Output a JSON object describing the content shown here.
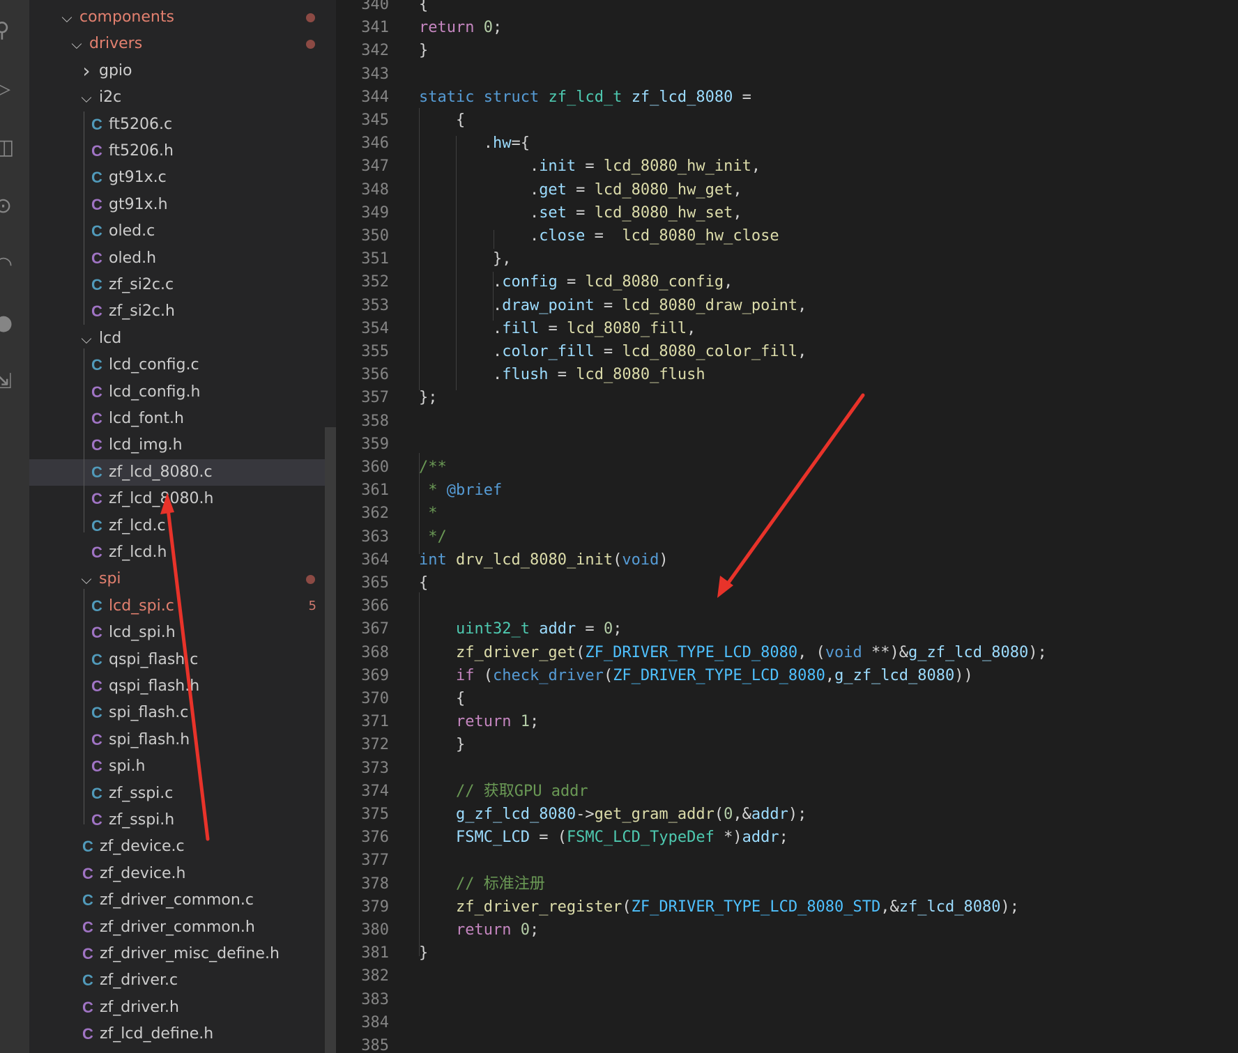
{
  "activity_bar": {
    "icons": [
      "source-control-icon",
      "run-debug-icon",
      "extensions-icon",
      "remote-explorer-icon",
      "wifi-icon",
      "github-icon",
      "live-share-icon"
    ]
  },
  "explorer": {
    "rows": [
      {
        "kind": "folder",
        "label": "components",
        "open": true,
        "modified": true,
        "depth": 0
      },
      {
        "kind": "folder",
        "label": "drivers",
        "open": true,
        "modified": true,
        "depth": 1
      },
      {
        "kind": "folder",
        "label": "gpio",
        "open": false,
        "depth": 2
      },
      {
        "kind": "folder",
        "label": "i2c",
        "open": true,
        "depth": 2
      },
      {
        "kind": "file",
        "label": "ft5206.c",
        "ext": "c",
        "depth": 3
      },
      {
        "kind": "file",
        "label": "ft5206.h",
        "ext": "h",
        "depth": 3
      },
      {
        "kind": "file",
        "label": "gt91x.c",
        "ext": "c",
        "depth": 3
      },
      {
        "kind": "file",
        "label": "gt91x.h",
        "ext": "h",
        "depth": 3
      },
      {
        "kind": "file",
        "label": "oled.c",
        "ext": "c",
        "depth": 3
      },
      {
        "kind": "file",
        "label": "oled.h",
        "ext": "h",
        "depth": 3
      },
      {
        "kind": "file",
        "label": "zf_si2c.c",
        "ext": "c",
        "depth": 3
      },
      {
        "kind": "file",
        "label": "zf_si2c.h",
        "ext": "h",
        "depth": 3
      },
      {
        "kind": "folder",
        "label": "lcd",
        "open": true,
        "depth": 2
      },
      {
        "kind": "file",
        "label": "lcd_config.c",
        "ext": "c",
        "depth": 3
      },
      {
        "kind": "file",
        "label": "lcd_config.h",
        "ext": "h",
        "depth": 3
      },
      {
        "kind": "file",
        "label": "lcd_font.h",
        "ext": "h",
        "depth": 3
      },
      {
        "kind": "file",
        "label": "lcd_img.h",
        "ext": "h",
        "depth": 3
      },
      {
        "kind": "file",
        "label": "zf_lcd_8080.c",
        "ext": "c",
        "depth": 3,
        "selected": true
      },
      {
        "kind": "file",
        "label": "zf_lcd_8080.h",
        "ext": "h",
        "depth": 3
      },
      {
        "kind": "file",
        "label": "zf_lcd.c",
        "ext": "c",
        "depth": 3
      },
      {
        "kind": "file",
        "label": "zf_lcd.h",
        "ext": "h",
        "depth": 3
      },
      {
        "kind": "folder",
        "label": "spi",
        "open": true,
        "modified": true,
        "depth": 2
      },
      {
        "kind": "file",
        "label": "lcd_spi.c",
        "ext": "c",
        "depth": 3,
        "modified": true,
        "count": "5"
      },
      {
        "kind": "file",
        "label": "lcd_spi.h",
        "ext": "h",
        "depth": 3
      },
      {
        "kind": "file",
        "label": "qspi_flash.c",
        "ext": "c",
        "depth": 3
      },
      {
        "kind": "file",
        "label": "qspi_flash.h",
        "ext": "h",
        "depth": 3
      },
      {
        "kind": "file",
        "label": "spi_flash.c",
        "ext": "c",
        "depth": 3
      },
      {
        "kind": "file",
        "label": "spi_flash.h",
        "ext": "h",
        "depth": 3
      },
      {
        "kind": "file",
        "label": "spi.h",
        "ext": "h",
        "depth": 3
      },
      {
        "kind": "file",
        "label": "zf_sspi.c",
        "ext": "c",
        "depth": 3
      },
      {
        "kind": "file",
        "label": "zf_sspi.h",
        "ext": "h",
        "depth": 3
      },
      {
        "kind": "file",
        "label": "zf_device.c",
        "ext": "c",
        "depth": 2
      },
      {
        "kind": "file",
        "label": "zf_device.h",
        "ext": "h",
        "depth": 2
      },
      {
        "kind": "file",
        "label": "zf_driver_common.c",
        "ext": "c",
        "depth": 2
      },
      {
        "kind": "file",
        "label": "zf_driver_common.h",
        "ext": "h",
        "depth": 2
      },
      {
        "kind": "file",
        "label": "zf_driver_misc_define.h",
        "ext": "h",
        "depth": 2
      },
      {
        "kind": "file",
        "label": "zf_driver.c",
        "ext": "c",
        "depth": 2
      },
      {
        "kind": "file",
        "label": "zf_driver.h",
        "ext": "h",
        "depth": 2
      },
      {
        "kind": "file",
        "label": "zf_lcd_define.h",
        "ext": "h",
        "depth": 2
      }
    ]
  },
  "editor": {
    "lines": [
      {
        "n": "340",
        "t": [
          {
            "s": "{"
          }
        ]
      },
      {
        "n": "341",
        "t": [
          {
            "s": "return",
            "c": "ctl"
          },
          {
            "s": " "
          },
          {
            "s": "0",
            "c": "num"
          },
          {
            "s": ";"
          }
        ]
      },
      {
        "n": "342",
        "t": [
          {
            "s": "}"
          }
        ]
      },
      {
        "n": "343",
        "t": []
      },
      {
        "n": "344",
        "t": [
          {
            "s": "static",
            "c": "kw"
          },
          {
            "s": " "
          },
          {
            "s": "struct",
            "c": "kw"
          },
          {
            "s": " "
          },
          {
            "s": "zf_lcd_t",
            "c": "typ"
          },
          {
            "s": " "
          },
          {
            "s": "zf_lcd_8080",
            "c": "var"
          },
          {
            "s": " ="
          }
        ]
      },
      {
        "n": "345",
        "t": [
          {
            "s": "    {"
          }
        ]
      },
      {
        "n": "346",
        "t": [
          {
            "s": "       ."
          },
          {
            "s": "hw",
            "c": "var"
          },
          {
            "s": "={"
          }
        ]
      },
      {
        "n": "347",
        "t": [
          {
            "s": "            ."
          },
          {
            "s": "init",
            "c": "var"
          },
          {
            "s": " = "
          },
          {
            "s": "lcd_8080_hw_init",
            "c": "fn"
          },
          {
            "s": ","
          }
        ]
      },
      {
        "n": "348",
        "t": [
          {
            "s": "            ."
          },
          {
            "s": "get",
            "c": "var"
          },
          {
            "s": " = "
          },
          {
            "s": "lcd_8080_hw_get",
            "c": "fn"
          },
          {
            "s": ","
          }
        ]
      },
      {
        "n": "349",
        "t": [
          {
            "s": "            ."
          },
          {
            "s": "set",
            "c": "var"
          },
          {
            "s": " = "
          },
          {
            "s": "lcd_8080_hw_set",
            "c": "fn"
          },
          {
            "s": ","
          }
        ]
      },
      {
        "n": "350",
        "t": [
          {
            "s": "            ."
          },
          {
            "s": "close",
            "c": "var"
          },
          {
            "s": " =  "
          },
          {
            "s": "lcd_8080_hw_close",
            "c": "fn"
          }
        ]
      },
      {
        "n": "351",
        "t": [
          {
            "s": "        },"
          }
        ]
      },
      {
        "n": "352",
        "t": [
          {
            "s": "        ."
          },
          {
            "s": "config",
            "c": "var"
          },
          {
            "s": " = "
          },
          {
            "s": "lcd_8080_config",
            "c": "fn"
          },
          {
            "s": ","
          }
        ]
      },
      {
        "n": "353",
        "t": [
          {
            "s": "        ."
          },
          {
            "s": "draw_point",
            "c": "var"
          },
          {
            "s": " = "
          },
          {
            "s": "lcd_8080_draw_point",
            "c": "fn"
          },
          {
            "s": ","
          }
        ]
      },
      {
        "n": "354",
        "t": [
          {
            "s": "        ."
          },
          {
            "s": "fill",
            "c": "var"
          },
          {
            "s": " = "
          },
          {
            "s": "lcd_8080_fill",
            "c": "fn"
          },
          {
            "s": ","
          }
        ]
      },
      {
        "n": "355",
        "t": [
          {
            "s": "        ."
          },
          {
            "s": "color_fill",
            "c": "var"
          },
          {
            "s": " = "
          },
          {
            "s": "lcd_8080_color_fill",
            "c": "fn"
          },
          {
            "s": ","
          }
        ]
      },
      {
        "n": "356",
        "t": [
          {
            "s": "        ."
          },
          {
            "s": "flush",
            "c": "var"
          },
          {
            "s": " = "
          },
          {
            "s": "lcd_8080_flush",
            "c": "fn"
          }
        ]
      },
      {
        "n": "357",
        "t": [
          {
            "s": "};"
          }
        ]
      },
      {
        "n": "358",
        "t": []
      },
      {
        "n": "359",
        "t": []
      },
      {
        "n": "360",
        "t": [
          {
            "s": "/**",
            "c": "cmt"
          }
        ]
      },
      {
        "n": "361",
        "t": [
          {
            "s": " * ",
            "c": "cmt"
          },
          {
            "s": "@brief",
            "c": "kw"
          }
        ]
      },
      {
        "n": "362",
        "t": [
          {
            "s": " *",
            "c": "cmt"
          }
        ]
      },
      {
        "n": "363",
        "t": [
          {
            "s": " */",
            "c": "cmt"
          }
        ]
      },
      {
        "n": "364",
        "t": [
          {
            "s": "int",
            "c": "kw"
          },
          {
            "s": " "
          },
          {
            "s": "drv_lcd_8080_init",
            "c": "fn"
          },
          {
            "s": "("
          },
          {
            "s": "void",
            "c": "kw"
          },
          {
            "s": ")"
          }
        ]
      },
      {
        "n": "365",
        "t": [
          {
            "s": "{"
          }
        ]
      },
      {
        "n": "366",
        "t": []
      },
      {
        "n": "367",
        "t": [
          {
            "s": "    "
          },
          {
            "s": "uint32_t",
            "c": "typ"
          },
          {
            "s": " "
          },
          {
            "s": "addr",
            "c": "var"
          },
          {
            "s": " = "
          },
          {
            "s": "0",
            "c": "num"
          },
          {
            "s": ";"
          }
        ]
      },
      {
        "n": "368",
        "t": [
          {
            "s": "    "
          },
          {
            "s": "zf_driver_get",
            "c": "fn"
          },
          {
            "s": "("
          },
          {
            "s": "ZF_DRIVER_TYPE_LCD_8080",
            "c": "mac"
          },
          {
            "s": ", ("
          },
          {
            "s": "void",
            "c": "kw"
          },
          {
            "s": " **)&"
          },
          {
            "s": "g_zf_lcd_8080",
            "c": "var"
          },
          {
            "s": ");"
          }
        ]
      },
      {
        "n": "369",
        "t": [
          {
            "s": "    "
          },
          {
            "s": "if",
            "c": "ctl"
          },
          {
            "s": " ("
          },
          {
            "s": "check_driver",
            "c": "kw"
          },
          {
            "s": "("
          },
          {
            "s": "ZF_DRIVER_TYPE_LCD_8080",
            "c": "mac"
          },
          {
            "s": ","
          },
          {
            "s": "g_zf_lcd_8080",
            "c": "var"
          },
          {
            "s": "))"
          }
        ]
      },
      {
        "n": "370",
        "t": [
          {
            "s": "    {"
          }
        ]
      },
      {
        "n": "371",
        "t": [
          {
            "s": "    "
          },
          {
            "s": "return",
            "c": "ctl"
          },
          {
            "s": " "
          },
          {
            "s": "1",
            "c": "num"
          },
          {
            "s": ";"
          }
        ]
      },
      {
        "n": "372",
        "t": [
          {
            "s": "    }"
          }
        ]
      },
      {
        "n": "373",
        "t": []
      },
      {
        "n": "374",
        "t": [
          {
            "s": "    // 获取GPU addr",
            "c": "cmt"
          }
        ]
      },
      {
        "n": "375",
        "t": [
          {
            "s": "    "
          },
          {
            "s": "g_zf_lcd_8080",
            "c": "var"
          },
          {
            "s": "->"
          },
          {
            "s": "get_gram_addr",
            "c": "fn"
          },
          {
            "s": "("
          },
          {
            "s": "0",
            "c": "num"
          },
          {
            "s": ",&"
          },
          {
            "s": "addr",
            "c": "var"
          },
          {
            "s": ");"
          }
        ]
      },
      {
        "n": "376",
        "t": [
          {
            "s": "    "
          },
          {
            "s": "FSMC_LCD",
            "c": "var"
          },
          {
            "s": " = ("
          },
          {
            "s": "FSMC_LCD_TypeDef",
            "c": "typ"
          },
          {
            "s": " *)"
          },
          {
            "s": "addr",
            "c": "var"
          },
          {
            "s": ";"
          }
        ]
      },
      {
        "n": "377",
        "t": []
      },
      {
        "n": "378",
        "t": [
          {
            "s": "    // 标准注册",
            "c": "cmt"
          }
        ]
      },
      {
        "n": "379",
        "t": [
          {
            "s": "    "
          },
          {
            "s": "zf_driver_register",
            "c": "fn"
          },
          {
            "s": "("
          },
          {
            "s": "ZF_DRIVER_TYPE_LCD_8080_STD",
            "c": "mac"
          },
          {
            "s": ",&"
          },
          {
            "s": "zf_lcd_8080",
            "c": "var"
          },
          {
            "s": ");"
          }
        ]
      },
      {
        "n": "380",
        "t": [
          {
            "s": "    "
          },
          {
            "s": "return",
            "c": "ctl"
          },
          {
            "s": " "
          },
          {
            "s": "0",
            "c": "num"
          },
          {
            "s": ";"
          }
        ]
      },
      {
        "n": "381",
        "t": [
          {
            "s": "}"
          }
        ]
      },
      {
        "n": "382",
        "t": []
      },
      {
        "n": "383",
        "t": []
      },
      {
        "n": "384",
        "t": []
      },
      {
        "n": "385",
        "t": []
      }
    ]
  },
  "colors": {
    "accent_arrow": "#e8332a",
    "modified_text": "#e2806f",
    "c_icon": "#519aba",
    "h_icon": "#a074c4"
  }
}
